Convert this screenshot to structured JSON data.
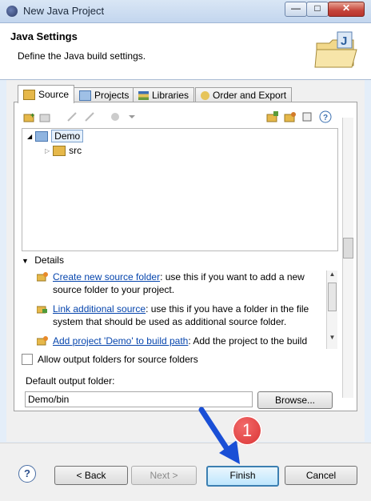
{
  "window": {
    "title": "New Java Project",
    "close_label": "✕",
    "minimize_label": "—",
    "maximize_label": "□"
  },
  "header": {
    "title": "Java Settings",
    "subtitle": "Define the Java build settings."
  },
  "tabs": [
    {
      "label": "Source"
    },
    {
      "label": "Projects"
    },
    {
      "label": "Libraries"
    },
    {
      "label": "Order and Export"
    }
  ],
  "tree": {
    "project": "Demo",
    "child": "src"
  },
  "details": {
    "header": "Details",
    "items": [
      {
        "link": "Create new source folder",
        "text": ": use this if you want to add a new source folder to your project."
      },
      {
        "link": "Link additional source",
        "text": ": use this if you have a folder in the file system that should be used as additional source folder."
      },
      {
        "link": "Add project 'Demo' to build path",
        "text": ": Add the project to the build path."
      }
    ]
  },
  "options": {
    "allow_output_folders": "Allow output folders for source folders",
    "allow_output_checked": false
  },
  "output": {
    "label": "Default output folder:",
    "value": "Demo/bin",
    "browse": "Browse..."
  },
  "buttons": {
    "help": "?",
    "back": "< Back",
    "next": "Next >",
    "finish": "Finish",
    "cancel": "Cancel"
  },
  "annotation": {
    "badge": "1"
  },
  "colors": {
    "link": "#0645ad",
    "badge": "#d93030",
    "arrow": "#1a4fd6"
  }
}
